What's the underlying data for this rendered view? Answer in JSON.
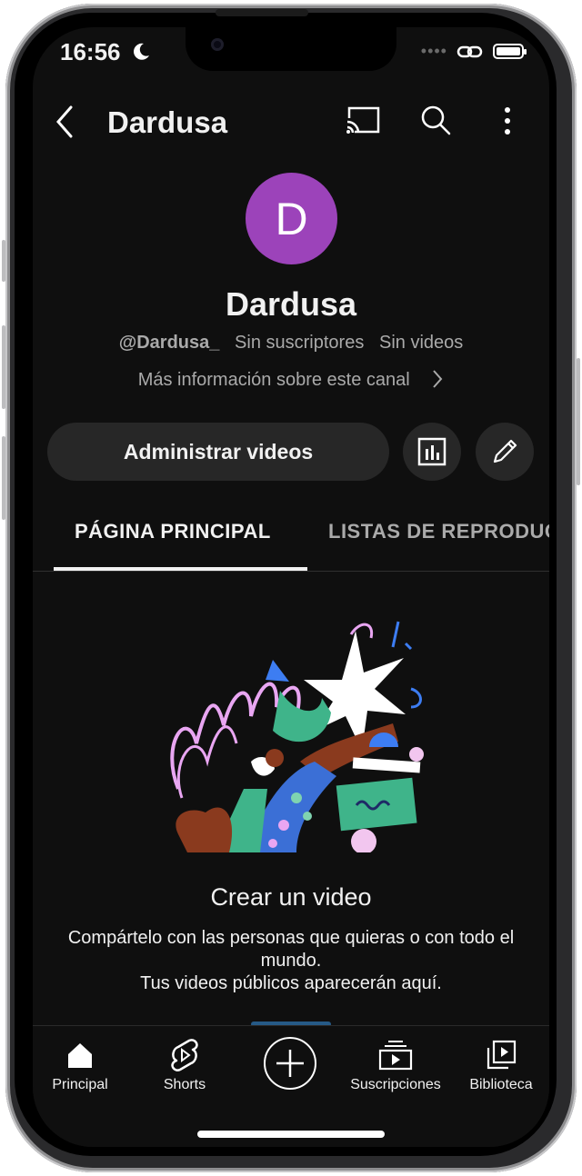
{
  "status_bar": {
    "time": "16:56",
    "dots": "••••"
  },
  "header": {
    "title": "Dardusa"
  },
  "channel": {
    "avatar_letter": "D",
    "name": "Dardusa",
    "handle": "@Dardusa_",
    "subscribers": "Sin suscriptores",
    "videos": "Sin videos",
    "more_info": "Más información sobre este canal"
  },
  "actions": {
    "manage_label": "Administrar videos"
  },
  "tabs": [
    {
      "label": "PÁGINA PRINCIPAL",
      "active": true
    },
    {
      "label": "LISTAS DE REPRODUCCIÓN",
      "active": false
    }
  ],
  "empty_state": {
    "title": "Crear un video",
    "line1": "Compártelo con las personas que quieras o con todo el mundo.",
    "line2": "Tus videos públicos aparecerán aquí."
  },
  "nav": [
    {
      "label": "Principal",
      "icon": "home-icon"
    },
    {
      "label": "Shorts",
      "icon": "shorts-icon"
    },
    {
      "label": "",
      "icon": "create-icon"
    },
    {
      "label": "Suscripciones",
      "icon": "subscriptions-icon"
    },
    {
      "label": "Biblioteca",
      "icon": "library-icon"
    }
  ],
  "colors": {
    "avatar": "#9c43ba",
    "background": "#0f0f0f",
    "button": "#272727",
    "accent": "#3ea6ff"
  }
}
